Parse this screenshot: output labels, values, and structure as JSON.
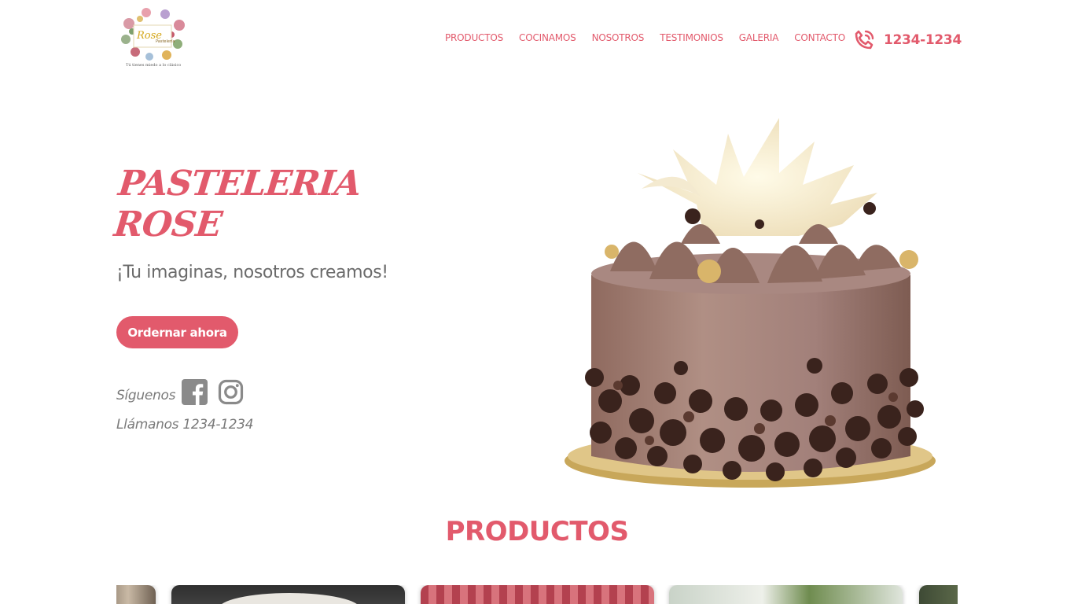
{
  "brand": {
    "logo_name": "Rose",
    "logo_sub": "Pastelería",
    "tagline": "Tú tienes miedo a lo clásico",
    "colors": {
      "accent": "#e25a6c",
      "text": "#6b6b6b"
    }
  },
  "nav": {
    "items": [
      {
        "label": "PRODUCTOS"
      },
      {
        "label": "COCINAMOS"
      },
      {
        "label": "NOSOTROS"
      },
      {
        "label": "TESTIMONIOS"
      },
      {
        "label": "GALERIA"
      },
      {
        "label": "CONTACTO"
      }
    ],
    "phone_icon": "phone-icon",
    "phone": "1234-1234"
  },
  "hero": {
    "title": "PASTELERIA ROSE",
    "subtitle": "¡Tu imaginas, nosotros creamos!",
    "cta_label": "Ordernar ahora",
    "follow_label": "Síguenos",
    "social_icons": [
      "facebook-icon",
      "instagram-icon"
    ],
    "call_label": "Llámanos 1234-1234",
    "image": "chocolate-cake-image"
  },
  "products": {
    "title": "PRODUCTOS",
    "cards": [
      "product-card",
      "product-card",
      "product-card",
      "product-card",
      "product-card"
    ]
  }
}
